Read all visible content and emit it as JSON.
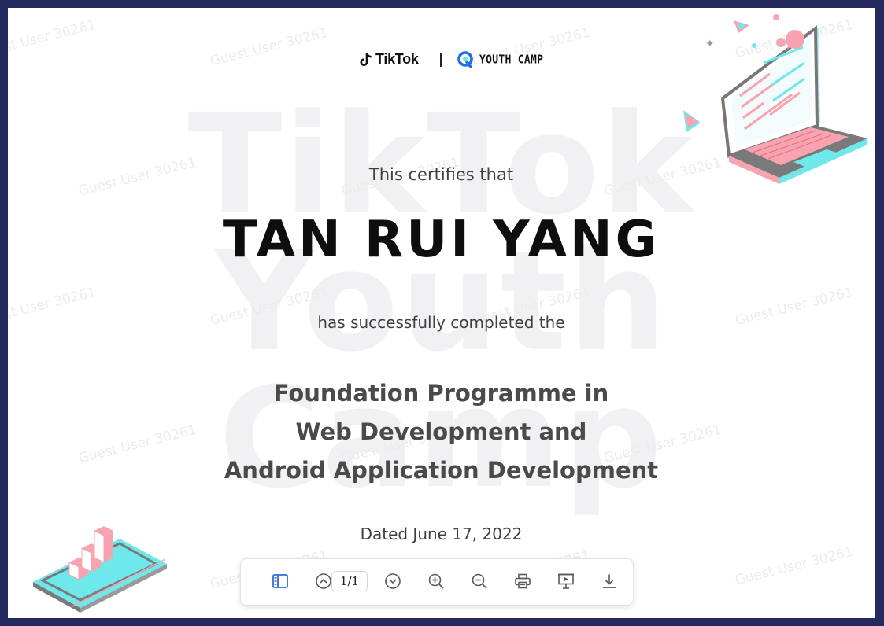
{
  "watermark": {
    "big_lines": [
      "TikTok",
      "Youth",
      "Camp"
    ],
    "user_text": "Guest User 30261"
  },
  "header": {
    "tiktok_logo_text": "TikTok",
    "youth_camp_logo_text": "YOUTH CAMP"
  },
  "certificate": {
    "intro": "This certifies that",
    "recipient": "TAN RUI YANG",
    "completed_text": "has successfully completed the",
    "programme_lines": [
      "Foundation Programme in",
      "Web Development and",
      "Android Application Development"
    ],
    "dated": "Dated June 17, 2022"
  },
  "colors": {
    "frame": "#252a5e",
    "accent_pink": "#f7a4b0",
    "accent_cyan": "#6ee8ea",
    "toolbar_icon": "#5a5a5a",
    "sidebar_icon": "#2e6fd6"
  },
  "toolbar": {
    "page_indicator": "1/1",
    "icons": [
      "sidebar-icon",
      "chevron-up-icon",
      "chevron-down-icon",
      "zoom-in-icon",
      "zoom-out-icon",
      "print-icon",
      "present-icon",
      "download-icon"
    ]
  }
}
